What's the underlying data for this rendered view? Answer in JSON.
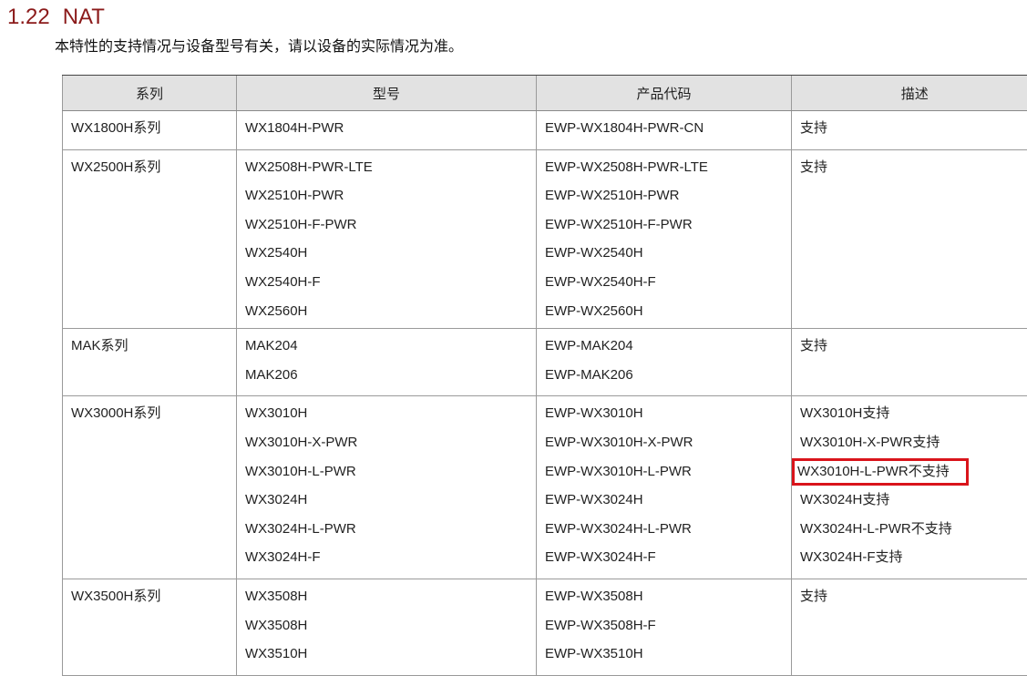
{
  "section": {
    "number": "1.22",
    "title": "NAT"
  },
  "note": "本特性的支持情况与设备型号有关，请以设备的实际情况为准。",
  "table": {
    "headers": [
      "系列",
      "型号",
      "产品代码",
      "描述"
    ],
    "groups": [
      {
        "series": "WX1800H系列",
        "models": [
          "WX1804H-PWR"
        ],
        "codes": [
          "EWP-WX1804H-PWR-CN"
        ],
        "descriptions": [
          "支持"
        ]
      },
      {
        "series": "WX2500H系列",
        "models": [
          "WX2508H-PWR-LTE",
          "WX2510H-PWR",
          "WX2510H-F-PWR",
          "WX2540H",
          "WX2540H-F",
          "WX2560H"
        ],
        "codes": [
          "EWP-WX2508H-PWR-LTE",
          "EWP-WX2510H-PWR",
          "EWP-WX2510H-F-PWR",
          "EWP-WX2540H",
          "EWP-WX2540H-F",
          "EWP-WX2560H"
        ],
        "descriptions": [
          "支持"
        ]
      },
      {
        "series": "MAK系列",
        "models": [
          "MAK204",
          "MAK206"
        ],
        "codes": [
          "EWP-MAK204",
          "EWP-MAK206"
        ],
        "descriptions": [
          "支持"
        ]
      },
      {
        "series": "WX3000H系列",
        "models": [
          "WX3010H",
          "WX3010H-X-PWR",
          "WX3010H-L-PWR",
          "WX3024H",
          "WX3024H-L-PWR",
          "WX3024H-F"
        ],
        "codes": [
          "EWP-WX3010H",
          "EWP-WX3010H-X-PWR",
          "EWP-WX3010H-L-PWR",
          "EWP-WX3024H",
          "EWP-WX3024H-L-PWR",
          "EWP-WX3024H-F"
        ],
        "descriptions": [
          "WX3010H支持",
          "WX3010H-X-PWR支持",
          "WX3010H-L-PWR不支持",
          "WX3024H支持",
          "WX3024H-L-PWR不支持",
          "WX3024H-F支持"
        ],
        "highlighted_description_index": 2,
        "highlight_color": "#d9141b"
      },
      {
        "series": "WX3500H系列",
        "models": [
          "WX3508H",
          "WX3508H",
          "WX3510H"
        ],
        "codes": [
          "EWP-WX3508H",
          "EWP-WX3508H-F",
          "EWP-WX3510H"
        ],
        "descriptions": [
          "支持"
        ]
      }
    ]
  },
  "colors": {
    "heading": "#8b1a1a",
    "header_bg": "#e2e2e2",
    "highlight_box": "#d9141b"
  }
}
